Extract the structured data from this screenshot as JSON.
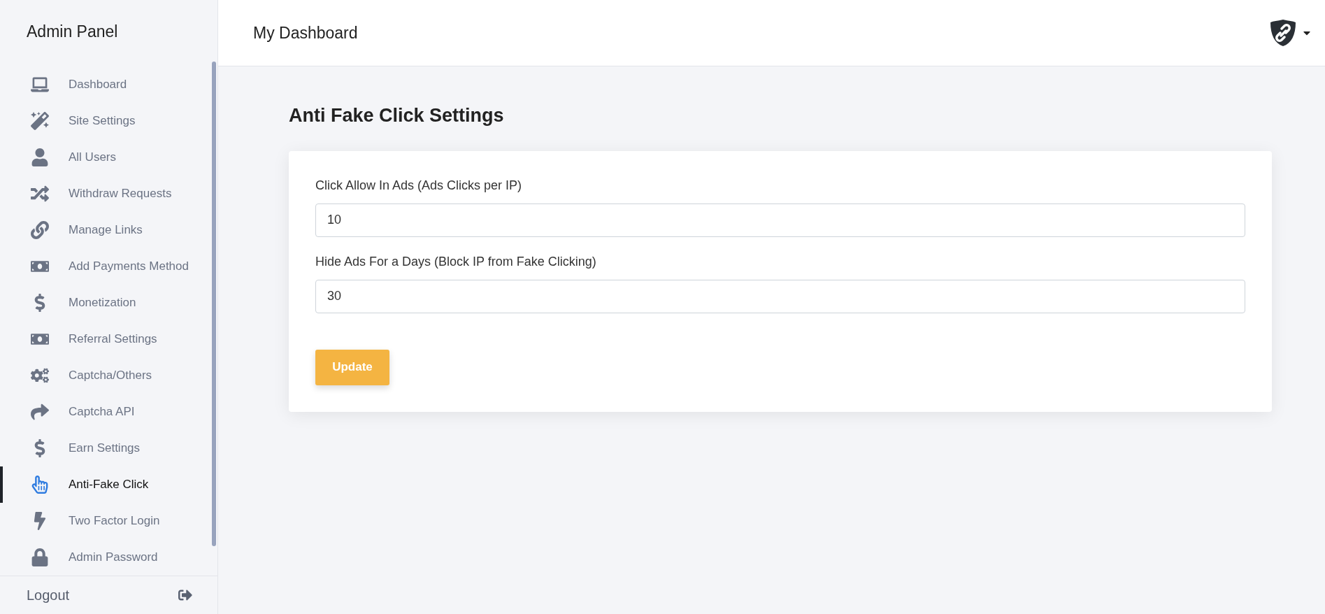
{
  "sidebar": {
    "title": "Admin Panel",
    "items": [
      {
        "label": "Dashboard",
        "selected": false
      },
      {
        "label": "Site Settings",
        "selected": false
      },
      {
        "label": "All Users",
        "selected": false
      },
      {
        "label": "Withdraw Requests",
        "selected": false
      },
      {
        "label": "Manage Links",
        "selected": false
      },
      {
        "label": "Add Payments Method",
        "selected": false
      },
      {
        "label": "Monetization",
        "selected": false
      },
      {
        "label": "Referral Settings",
        "selected": false
      },
      {
        "label": "Captcha/Others",
        "selected": false
      },
      {
        "label": "Captcha API",
        "selected": false
      },
      {
        "label": "Earn Settings",
        "selected": false
      },
      {
        "label": "Anti-Fake Click",
        "selected": true
      },
      {
        "label": "Two Factor Login",
        "selected": false
      },
      {
        "label": "Admin Password",
        "selected": false
      }
    ],
    "logout": "Logout"
  },
  "header": {
    "title": "My Dashboard"
  },
  "page": {
    "heading": "Anti Fake Click Settings",
    "fields": [
      {
        "label": "Click Allow In Ads (Ads Clicks per IP)",
        "value": "10"
      },
      {
        "label": "Hide Ads For a Days (Block IP from Fake Clicking)",
        "value": "30"
      }
    ],
    "button": "Update"
  }
}
